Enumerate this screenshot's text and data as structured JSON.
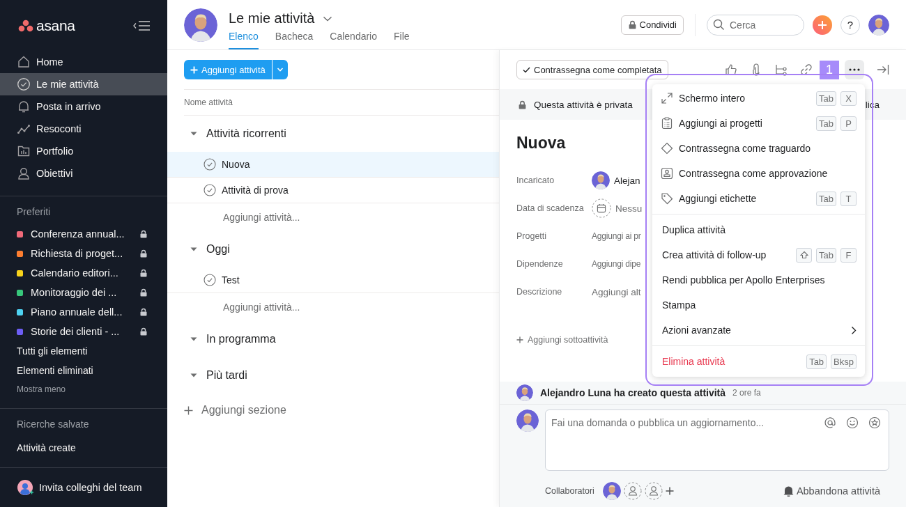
{
  "sidebar": {
    "logo": "asana",
    "nav": [
      {
        "label": "Home",
        "selected": false
      },
      {
        "label": "Le mie attività",
        "selected": true
      },
      {
        "label": "Posta in arrivo",
        "selected": false
      },
      {
        "label": "Resoconti",
        "selected": false
      },
      {
        "label": "Portfolio",
        "selected": false
      },
      {
        "label": "Obiettivi",
        "selected": false
      }
    ],
    "favorites_heading": "Preferiti",
    "favorites": [
      {
        "label": "Conferenza annual...",
        "color": "#f06a79",
        "locked": true
      },
      {
        "label": "Richiesta di proget...",
        "color": "#fd7e30",
        "locked": true
      },
      {
        "label": "Calendario editori...",
        "color": "#f8d31b",
        "locked": true
      },
      {
        "label": "Monitoraggio dei ...",
        "color": "#37c77b",
        "locked": true
      },
      {
        "label": "Piano annuale dell...",
        "color": "#4ed3f2",
        "locked": true
      },
      {
        "label": "Storie dei clienti - ...",
        "color": "#6d5ef5",
        "locked": true
      }
    ],
    "links": [
      "Tutti gli elementi",
      "Elementi eliminati"
    ],
    "show_less": "Mostra meno",
    "saved_heading": "Ricerche salvate",
    "saved": [
      "Attività create"
    ],
    "invite": "Invita colleghi del team"
  },
  "header": {
    "title": "Le mie attività",
    "tabs": [
      {
        "label": "Elenco",
        "selected": true
      },
      {
        "label": "Bacheca",
        "selected": false
      },
      {
        "label": "Calendario",
        "selected": false
      },
      {
        "label": "File",
        "selected": false
      }
    ],
    "share": "Condividi",
    "search": {
      "placeholder": "Cerca"
    },
    "help": "?"
  },
  "list": {
    "add_button": "Aggiungi attività",
    "column": "Nome attività",
    "sections": [
      {
        "title": "Attività ricorrenti",
        "expanded": true,
        "tasks": [
          {
            "name": "Nuova",
            "selected": true
          },
          {
            "name": "Attività di prova",
            "selected": false
          }
        ],
        "add_task": "Aggiungi attività..."
      },
      {
        "title": "Oggi",
        "expanded": true,
        "tasks": [
          {
            "name": "Test",
            "selected": false
          }
        ],
        "add_task": "Aggiungi attività..."
      },
      {
        "title": "In programma",
        "expanded": true
      },
      {
        "title": "Più tardi",
        "expanded": true
      }
    ],
    "add_section": "Aggiungi sezione"
  },
  "detail": {
    "complete_button": "Contrassegna come completata",
    "badge": "1",
    "privacy": "Questa attività è privata",
    "privacy_tail": "lica",
    "title": "Nuova",
    "fields": [
      {
        "label": "Incaricato",
        "kind": "person",
        "value": "Alejan"
      },
      {
        "label": "Data di scadenza",
        "kind": "date",
        "value": "Nessu"
      },
      {
        "label": "Progetti",
        "kind": "text",
        "value": "Aggiungi ai pr"
      },
      {
        "label": "Dipendenze",
        "kind": "text",
        "value": "Aggiungi dipe"
      },
      {
        "label": "Descrizione",
        "kind": "description",
        "value": "Aggiungi alt"
      }
    ],
    "add_subtask": "Aggiungi sottoattività",
    "activity": {
      "text": "Alejandro Luna ha creato questa attività",
      "time": "2 ore fa"
    },
    "comment": {
      "placeholder": "Fai una domanda o pubblica un aggiornamento..."
    },
    "collaborators": "Collaboratori",
    "leave": "Abbandona attività"
  },
  "menu": {
    "groups": [
      [
        {
          "kind": "icon",
          "label": "Schermo intero",
          "keys": [
            "Tab",
            "X"
          ]
        },
        {
          "kind": "icon",
          "label": "Aggiungi ai progetti",
          "keys": [
            "Tab",
            "P"
          ]
        },
        {
          "kind": "icon",
          "label": "Contrassegna come traguardo"
        },
        {
          "kind": "icon",
          "label": "Contrassegna come approvazione"
        },
        {
          "kind": "icon",
          "label": "Aggiungi etichette",
          "keys": [
            "Tab",
            "T"
          ]
        }
      ],
      [
        {
          "kind": "plain",
          "label": "Duplica attività"
        },
        {
          "kind": "plain",
          "label": "Crea attività di follow-up",
          "shift": true,
          "keys": [
            "Tab",
            "F"
          ]
        },
        {
          "kind": "plain",
          "label": "Rendi pubblica per Apollo Enterprises"
        },
        {
          "kind": "plain",
          "label": "Stampa"
        },
        {
          "kind": "submenu",
          "label": "Azioni avanzate"
        }
      ],
      [
        {
          "kind": "danger",
          "label": "Elimina attività",
          "keys": [
            "Tab",
            "Bksp"
          ]
        }
      ]
    ]
  }
}
